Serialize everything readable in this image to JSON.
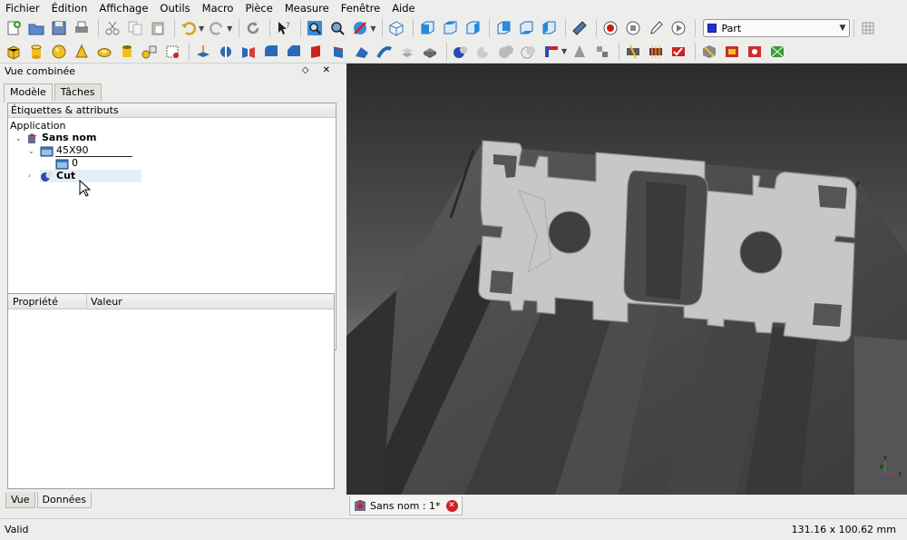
{
  "menu": [
    {
      "label": "Fichier",
      "key": "F"
    },
    {
      "label": "Édition",
      "key": "É"
    },
    {
      "label": "Affichage",
      "key": "A"
    },
    {
      "label": "Outils",
      "key": "O"
    },
    {
      "label": "Macro",
      "key": "M"
    },
    {
      "label": "Pièce",
      "key": "P"
    },
    {
      "label": "Measure",
      "key": ""
    },
    {
      "label": "Fenêtre",
      "key": "F"
    },
    {
      "label": "Aide",
      "key": "A"
    }
  ],
  "workbench": {
    "selected": "Part",
    "color": "#2030d0"
  },
  "dock": {
    "title": "Vue combinée",
    "buttons": "◇ ✕",
    "tabs": [
      "Modèle",
      "Tâches"
    ],
    "active_tab": "Modèle",
    "model_header": "Étiquettes & attributs",
    "tree": {
      "root": "Application",
      "document": "Sans nom",
      "items": [
        {
          "label": "45X90",
          "icon": "folder-icon",
          "expanded": true
        },
        {
          "label": "0",
          "icon": "folder-icon"
        },
        {
          "label": "Cut",
          "icon": "cut-shape-icon",
          "selected": true
        }
      ]
    },
    "property_columns": [
      "Propriété",
      "Valeur"
    ],
    "bottom_tabs": [
      "Vue",
      "Données"
    ],
    "active_bottom_tab": "Données"
  },
  "document_tab": {
    "label": "Sans nom : 1*",
    "close": "✕"
  },
  "status": {
    "left": "Valid",
    "right": "131.16 x 100.62 mm"
  },
  "axis": {
    "x": "x",
    "y": "y",
    "z": "z"
  },
  "colors": {
    "accent": "#2a6ab8",
    "profile_face": "#c7c7c7",
    "profile_body": "#4a4a4a"
  }
}
